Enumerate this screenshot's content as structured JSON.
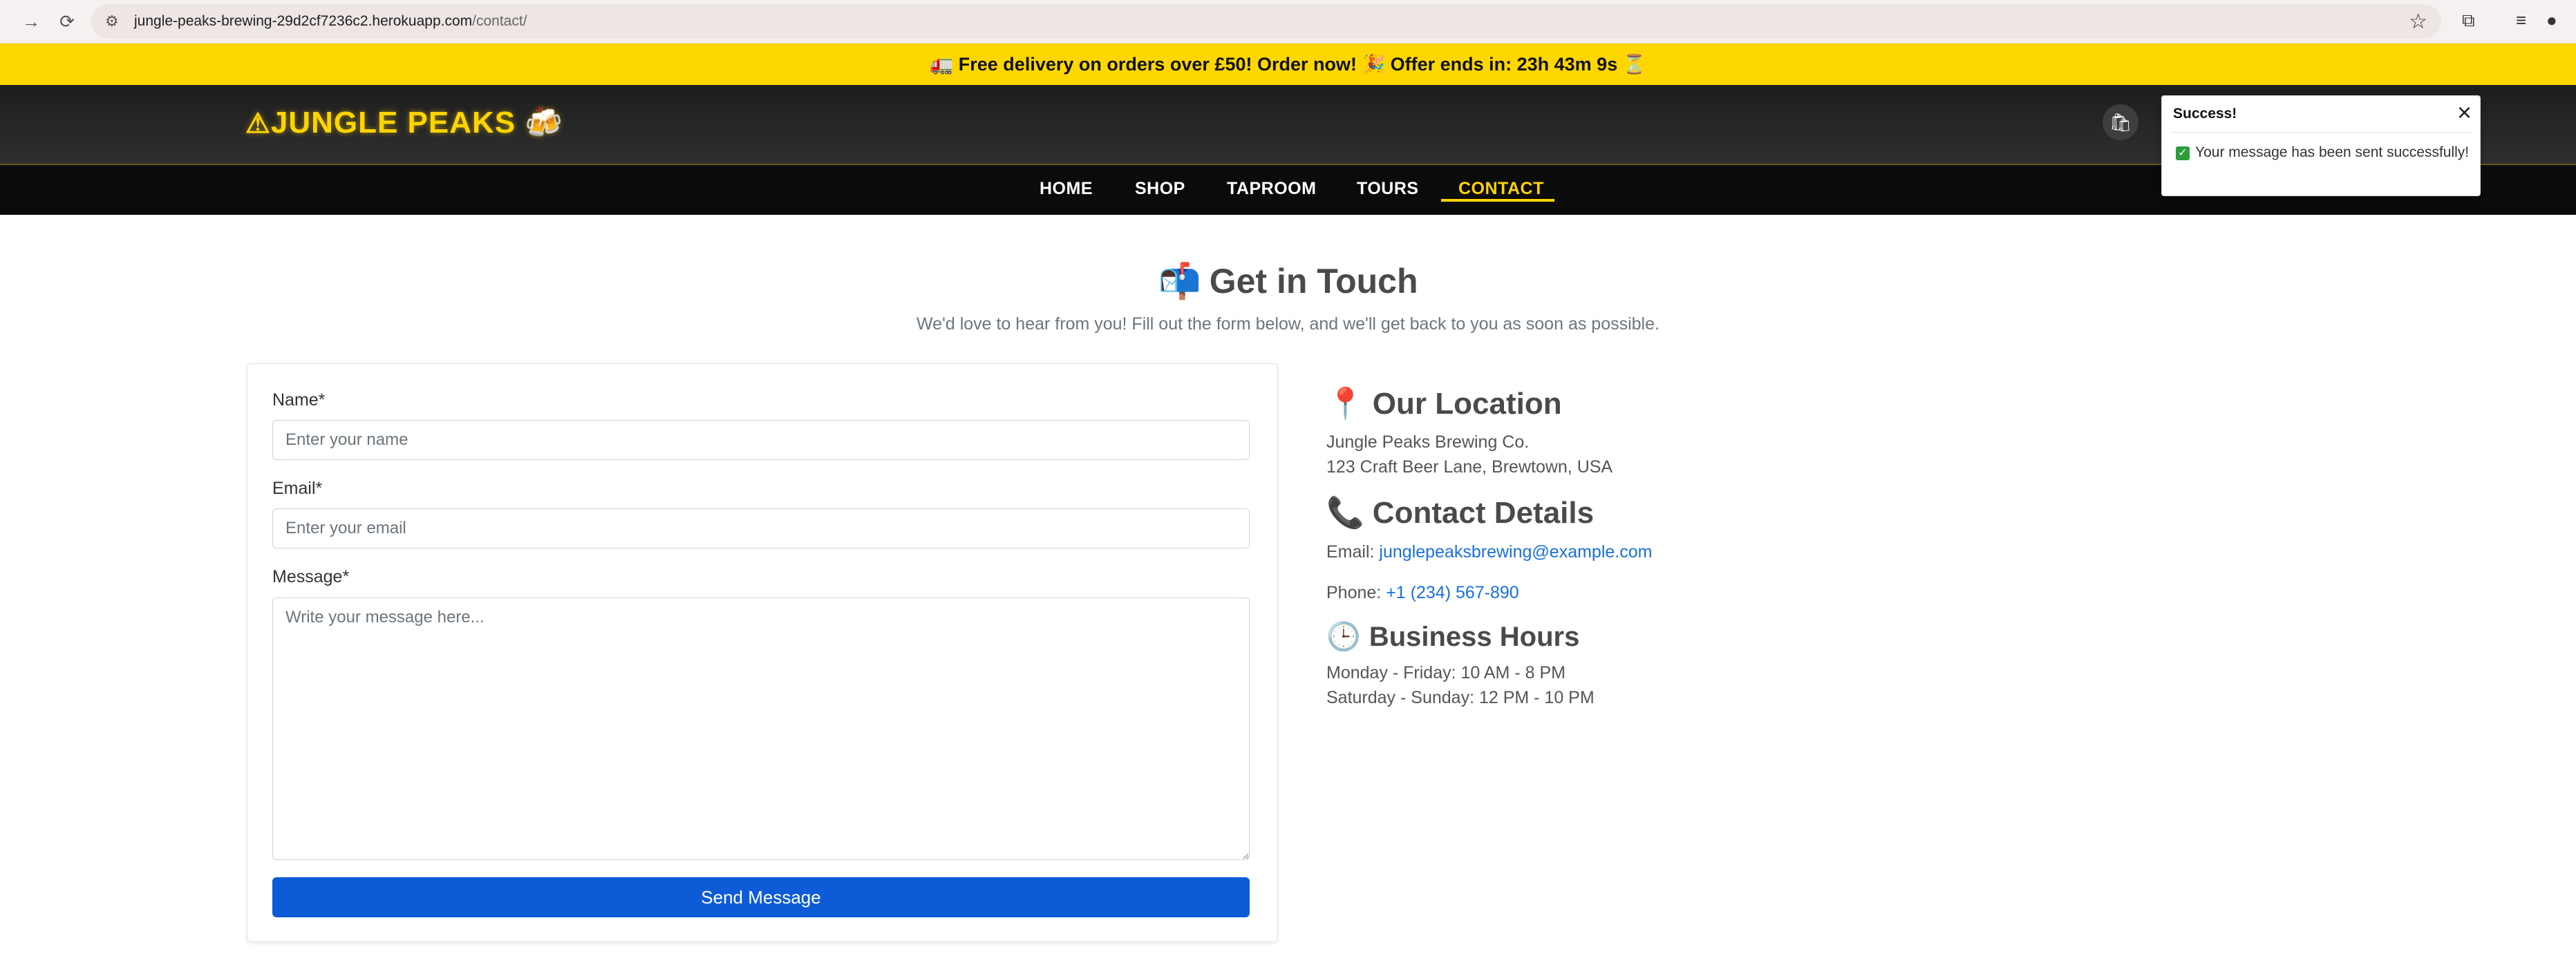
{
  "browser": {
    "url_host": "jungle-peaks-brewing-29d2cf7236c2.herokuapp.com",
    "url_path": "/contact/"
  },
  "promo": {
    "text": "🚛 Free delivery on orders over £50! Order now! 🎉 Offer ends in: 23h 43m 9s ⏳"
  },
  "header": {
    "logo_icon": "⚠",
    "logo_text": "JUNGLE PEAKS",
    "logo_emoji": "🍻"
  },
  "nav": {
    "items": [
      {
        "label": "HOME"
      },
      {
        "label": "SHOP"
      },
      {
        "label": "TAPROOM"
      },
      {
        "label": "TOURS"
      },
      {
        "label": "CONTACT",
        "active": true
      }
    ]
  },
  "page": {
    "title_emoji": "📬",
    "title": "Get in Touch",
    "subtitle": "We'd love to hear from you! Fill out the form below, and we'll get back to you as soon as possible."
  },
  "form": {
    "name_label": "Name*",
    "name_placeholder": "Enter your name",
    "email_label": "Email*",
    "email_placeholder": "Enter your email",
    "message_label": "Message*",
    "message_placeholder": "Write your message here...",
    "submit_label": "Send Message"
  },
  "location": {
    "emoji": "📍",
    "title": "Our Location",
    "line1": "Jungle Peaks Brewing Co.",
    "line2": "123 Craft Beer Lane, Brewtown, USA"
  },
  "contact": {
    "emoji": "📞",
    "title": "Contact Details",
    "email_label": "Email:",
    "email_value": "junglepeaksbrewing@example.com",
    "phone_label": "Phone:",
    "phone_value": "+1 (234) 567-890"
  },
  "hours": {
    "emoji": "🕒",
    "title": "Business Hours",
    "weekday": "Monday - Friday: 10 AM - 8 PM",
    "weekend": "Saturday - Sunday: 12 PM - 10 PM"
  },
  "toast": {
    "title": "Success!",
    "message": "Your message has been sent successfully!"
  },
  "colors": {
    "accent_yellow": "#ffd700",
    "primary_blue": "#0d5bd7",
    "link_blue": "#1a6fe0"
  }
}
